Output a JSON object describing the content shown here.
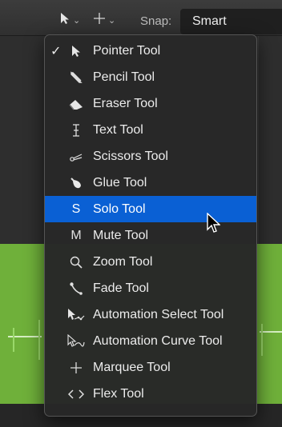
{
  "toolbar": {
    "left_tool_icon": "pointer-icon",
    "right_tool_icon": "marquee-crosshair-icon",
    "snap_label": "Snap:",
    "snap_value": "Smart"
  },
  "tool_menu": {
    "items": [
      {
        "label": "Pointer Tool",
        "icon": "pointer-icon",
        "checked": true,
        "check": "✓"
      },
      {
        "label": "Pencil Tool",
        "icon": "pencil-icon"
      },
      {
        "label": "Eraser Tool",
        "icon": "eraser-icon"
      },
      {
        "label": "Text Tool",
        "icon": "text-cursor-icon"
      },
      {
        "label": "Scissors Tool",
        "icon": "scissors-icon"
      },
      {
        "label": "Glue Tool",
        "icon": "glue-icon"
      },
      {
        "label": "Solo Tool",
        "icon": "solo-icon",
        "glyph": "S",
        "highlighted": true
      },
      {
        "label": "Mute Tool",
        "icon": "mute-icon",
        "glyph": "M"
      },
      {
        "label": "Zoom Tool",
        "icon": "zoom-icon"
      },
      {
        "label": "Fade Tool",
        "icon": "fade-icon"
      },
      {
        "label": "Automation Select Tool",
        "icon": "automation-select-icon"
      },
      {
        "label": "Automation Curve Tool",
        "icon": "automation-curve-icon"
      },
      {
        "label": "Marquee Tool",
        "icon": "marquee-icon"
      },
      {
        "label": "Flex Tool",
        "icon": "flex-icon"
      }
    ]
  },
  "colors": {
    "highlight": "#0a60d4",
    "region_green": "#6fb03a"
  }
}
